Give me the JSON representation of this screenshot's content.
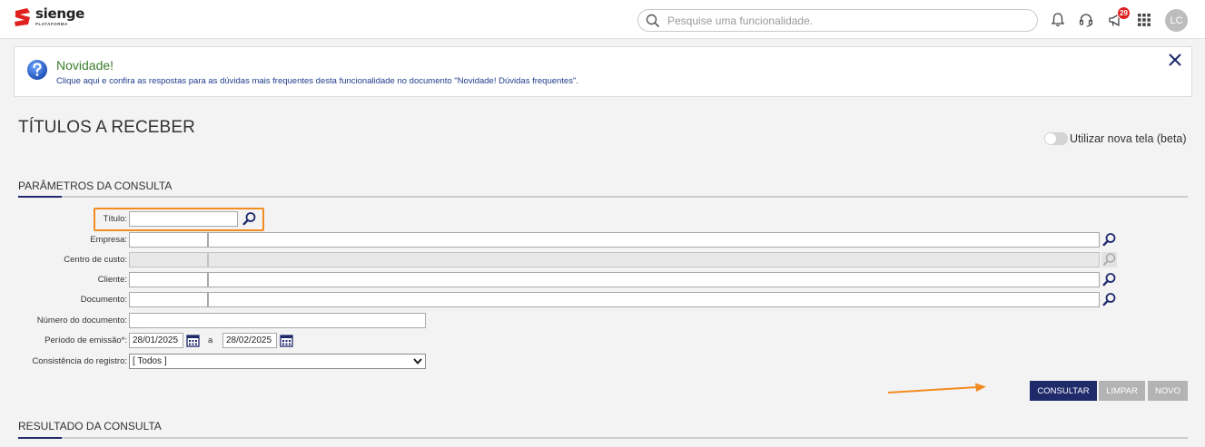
{
  "brand": {
    "name": "sienge",
    "subtitle": "PLATAFORMA",
    "color": "#e0201f"
  },
  "header": {
    "search_placeholder": "Pesquise uma funcionalidade.",
    "notifications_badge": "29",
    "avatar_initials": "LC"
  },
  "notice": {
    "title": "Novidade!",
    "text": "Clique aqui e confira as respostas para as dúvidas mais frequentes desta funcionalidade no documento \"Novidade! Dúvidas frequentes\"."
  },
  "page": {
    "title": "TÍTULOS A RECEBER",
    "toggle_label": "Utilizar nova tela (beta)",
    "toggle_on": false
  },
  "params": {
    "section_title": "PARÂMETROS DA CONSULTA",
    "titulo_label": "Título:",
    "empresa_label": "Empresa:",
    "centro_label": "Centro de custo:",
    "cliente_label": "Cliente:",
    "documento_label": "Documento:",
    "numero_label": "Número do documento:",
    "periodo_label": "Período de emissão*:",
    "periodo_inicio": "28/01/2025",
    "periodo_sep": "a",
    "periodo_fim": "28/02/2025",
    "consistencia_label": "Consistência do registro:",
    "consistencia_value": "[ Todos ]"
  },
  "buttons": {
    "consultar": "CONSULTAR",
    "limpar": "LIMPAR",
    "novo": "NOVO"
  },
  "results": {
    "section_title": "RESULTADO DA CONSULTA"
  },
  "colors": {
    "primary": "#1f2a6b",
    "highlight": "#f28b20",
    "notice_title": "#3b7d2b",
    "link": "#1e3c8c"
  }
}
